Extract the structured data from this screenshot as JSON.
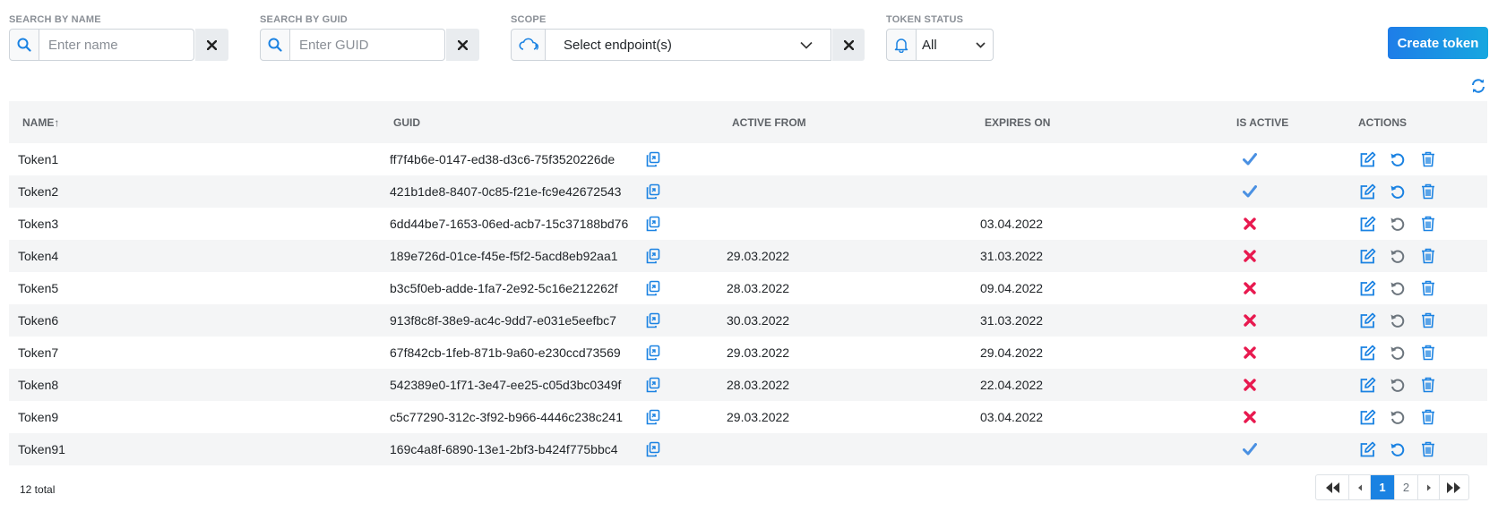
{
  "filters": {
    "name": {
      "label": "SEARCH BY NAME",
      "placeholder": "Enter name",
      "value": ""
    },
    "guid": {
      "label": "SEARCH BY GUID",
      "placeholder": "Enter GUID",
      "value": ""
    },
    "scope": {
      "label": "SCOPE",
      "value": "Select endpoint(s)"
    },
    "status": {
      "label": "TOKEN STATUS",
      "value": "All"
    }
  },
  "create_button": "Create token",
  "table": {
    "headers": {
      "name": "NAME↑",
      "guid": "GUID",
      "active_from": "ACTIVE FROM",
      "expires_on": "EXPIRES ON",
      "is_active": "IS ACTIVE",
      "actions": "ACTIONS"
    },
    "rows": [
      {
        "name": "Token1",
        "guid": "ff7f4b6e-0147-ed38-d3c6-75f3520226de",
        "active_from": "",
        "expires_on": "",
        "is_active": true
      },
      {
        "name": "Token2",
        "guid": "421b1de8-8407-0c85-f21e-fc9e42672543",
        "active_from": "",
        "expires_on": "",
        "is_active": true
      },
      {
        "name": "Token3",
        "guid": "6dd44be7-1653-06ed-acb7-15c37188bd76",
        "active_from": "",
        "expires_on": "03.04.2022",
        "is_active": false
      },
      {
        "name": "Token4",
        "guid": "189e726d-01ce-f45e-f5f2-5acd8eb92aa1",
        "active_from": "29.03.2022",
        "expires_on": "31.03.2022",
        "is_active": false
      },
      {
        "name": "Token5",
        "guid": "b3c5f0eb-adde-1fa7-2e92-5c16e212262f",
        "active_from": "28.03.2022",
        "expires_on": "09.04.2022",
        "is_active": false
      },
      {
        "name": "Token6",
        "guid": "913f8c8f-38e9-ac4c-9dd7-e031e5eefbc7",
        "active_from": "30.03.2022",
        "expires_on": "31.03.2022",
        "is_active": false
      },
      {
        "name": "Token7",
        "guid": "67f842cb-1feb-871b-9a60-e230ccd73569",
        "active_from": "29.03.2022",
        "expires_on": "29.04.2022",
        "is_active": false
      },
      {
        "name": "Token8",
        "guid": "542389e0-1f71-3e47-ee25-c05d3bc0349f",
        "active_from": "28.03.2022",
        "expires_on": "22.04.2022",
        "is_active": false
      },
      {
        "name": "Token9",
        "guid": "c5c77290-312c-3f92-b966-4446c238c241",
        "active_from": "29.03.2022",
        "expires_on": "03.04.2022",
        "is_active": false
      },
      {
        "name": "Token91",
        "guid": "169c4a8f-6890-13e1-2bf3-b424f775bbc4",
        "active_from": "",
        "expires_on": "",
        "is_active": true
      }
    ]
  },
  "footer": {
    "total": "12 total",
    "pages": [
      "1",
      "2"
    ],
    "current_page": "1"
  },
  "colors": {
    "accent": "#1a82e2",
    "check": "#4a90e2",
    "cross": "#e8194f",
    "muted_icon": "#6c757d",
    "header_bg": "#f4f5f6"
  },
  "icons": {
    "name_addon": "search-icon",
    "guid_addon": "search-icon",
    "scope_addon": "cloud-icon",
    "status_addon": "bell-icon",
    "clear": "close-icon",
    "copy": "copy-icon",
    "edit": "edit-icon",
    "regenerate": "undo-icon",
    "delete": "trash-icon",
    "refresh": "refresh-icon"
  }
}
